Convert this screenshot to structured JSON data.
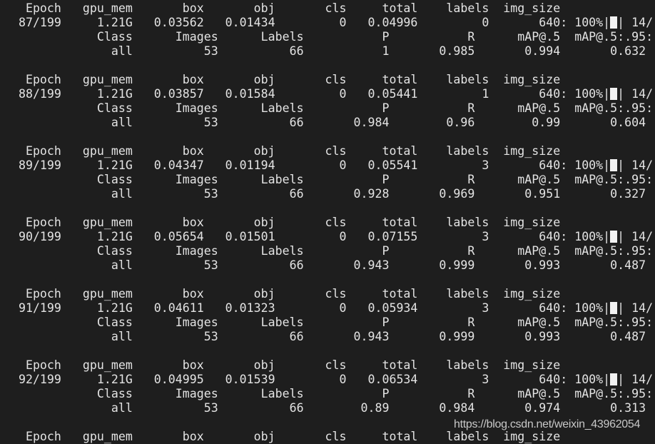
{
  "terminal": {
    "header_columns": [
      "Epoch",
      "gpu_mem",
      "box",
      "obj",
      "cls",
      "total",
      "labels",
      "img_size"
    ],
    "val_columns": [
      "Class",
      "Images",
      "Labels",
      "P",
      "R",
      "mAP@.5",
      "mAP@.5:.95"
    ],
    "progress_suffix": ": 100%|",
    "progress_percent": 100,
    "batch_progress_text": "| 14/",
    "val_progress_text": ": 100%|",
    "epochs": [
      {
        "epoch": "87/199",
        "gpu_mem": "1.21G",
        "box": "0.03562",
        "obj": "0.01434",
        "cls": "0",
        "total": "0.04996",
        "labels": "0",
        "img_size": "640",
        "class": "all",
        "images": "53",
        "num_labels": "66",
        "P": "1",
        "R": "0.985",
        "map50": "0.994",
        "map50_95": "0.632"
      },
      {
        "epoch": "88/199",
        "gpu_mem": "1.21G",
        "box": "0.03857",
        "obj": "0.01584",
        "cls": "0",
        "total": "0.05441",
        "labels": "1",
        "img_size": "640",
        "class": "all",
        "images": "53",
        "num_labels": "66",
        "P": "0.984",
        "R": "0.96",
        "map50": "0.99",
        "map50_95": "0.604"
      },
      {
        "epoch": "89/199",
        "gpu_mem": "1.21G",
        "box": "0.04347",
        "obj": "0.01194",
        "cls": "0",
        "total": "0.05541",
        "labels": "3",
        "img_size": "640",
        "class": "all",
        "images": "53",
        "num_labels": "66",
        "P": "0.928",
        "R": "0.969",
        "map50": "0.951",
        "map50_95": "0.327"
      },
      {
        "epoch": "90/199",
        "gpu_mem": "1.21G",
        "box": "0.05654",
        "obj": "0.01501",
        "cls": "0",
        "total": "0.07155",
        "labels": "3",
        "img_size": "640",
        "class": "all",
        "images": "53",
        "num_labels": "66",
        "P": "0.943",
        "R": "0.999",
        "map50": "0.993",
        "map50_95": "0.487"
      },
      {
        "epoch": "91/199",
        "gpu_mem": "1.21G",
        "box": "0.04611",
        "obj": "0.01323",
        "cls": "0",
        "total": "0.05934",
        "labels": "3",
        "img_size": "640",
        "class": "all",
        "images": "53",
        "num_labels": "66",
        "P": "0.943",
        "R": "0.999",
        "map50": "0.993",
        "map50_95": "0.487"
      },
      {
        "epoch": "92/199",
        "gpu_mem": "1.21G",
        "box": "0.04995",
        "obj": "0.01539",
        "cls": "0",
        "total": "0.06534",
        "labels": "3",
        "img_size": "640",
        "class": "all",
        "images": "53",
        "num_labels": "66",
        "P": "0.89",
        "R": "0.984",
        "map50": "0.974",
        "map50_95": "0.313"
      }
    ],
    "trailing_partial_header": true
  },
  "watermark": "https://blog.csdn.net/weixin_43962054"
}
